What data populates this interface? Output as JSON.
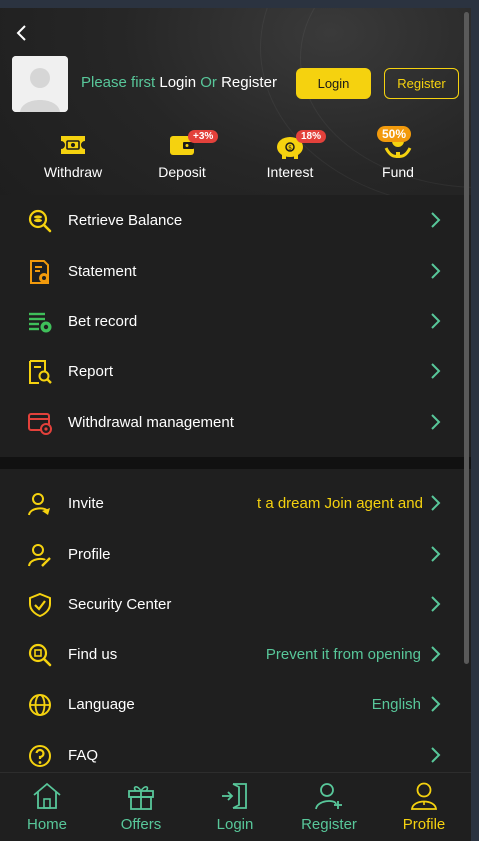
{
  "header": {
    "prompt_prefix": "Please first ",
    "prompt_login": "Login",
    "prompt_or": " Or ",
    "prompt_register": "Register",
    "login_button": "Login",
    "register_button": "Register"
  },
  "quick_actions": [
    {
      "label": "Withdraw",
      "icon": "ticket-icon",
      "badge": ""
    },
    {
      "label": "Deposit",
      "icon": "wallet-icon",
      "badge": "+3%"
    },
    {
      "label": "Interest",
      "icon": "piggy-bank-icon",
      "badge": "18%"
    },
    {
      "label": "Fund",
      "icon": "hand-coin-icon",
      "badge": "50%"
    }
  ],
  "menu1": [
    {
      "label": "Retrieve Balance",
      "icon": "coin-search-icon"
    },
    {
      "label": "Statement",
      "icon": "statement-icon"
    },
    {
      "label": "Bet record",
      "icon": "bet-record-icon"
    },
    {
      "label": "Report",
      "icon": "report-search-icon"
    },
    {
      "label": "Withdrawal management",
      "icon": "card-settings-icon"
    }
  ],
  "menu2": [
    {
      "label": "Invite",
      "icon": "invite-user-icon",
      "value": "t a dream  Join agent and"
    },
    {
      "label": "Profile",
      "icon": "user-edit-icon",
      "value": ""
    },
    {
      "label": "Security Center",
      "icon": "shield-check-icon",
      "value": ""
    },
    {
      "label": "Find us",
      "icon": "find-us-icon",
      "value": "Prevent it from opening"
    },
    {
      "label": "Language",
      "icon": "globe-icon",
      "value": "English"
    },
    {
      "label": "FAQ",
      "icon": "question-icon",
      "value": ""
    }
  ],
  "tabbar": [
    {
      "label": "Home",
      "icon": "home-icon",
      "active": false
    },
    {
      "label": "Offers",
      "icon": "gift-icon",
      "active": false
    },
    {
      "label": "Login",
      "icon": "login-icon",
      "active": false
    },
    {
      "label": "Register",
      "icon": "add-user-icon",
      "active": false
    },
    {
      "label": "Profile",
      "icon": "profile-icon",
      "active": true
    }
  ],
  "colors": {
    "accent_yellow": "#f5d20f",
    "accent_green": "#58c79a",
    "badge_red": "#e3413b",
    "badge_orange": "#f29a0c",
    "background": "#1f1f1f"
  }
}
